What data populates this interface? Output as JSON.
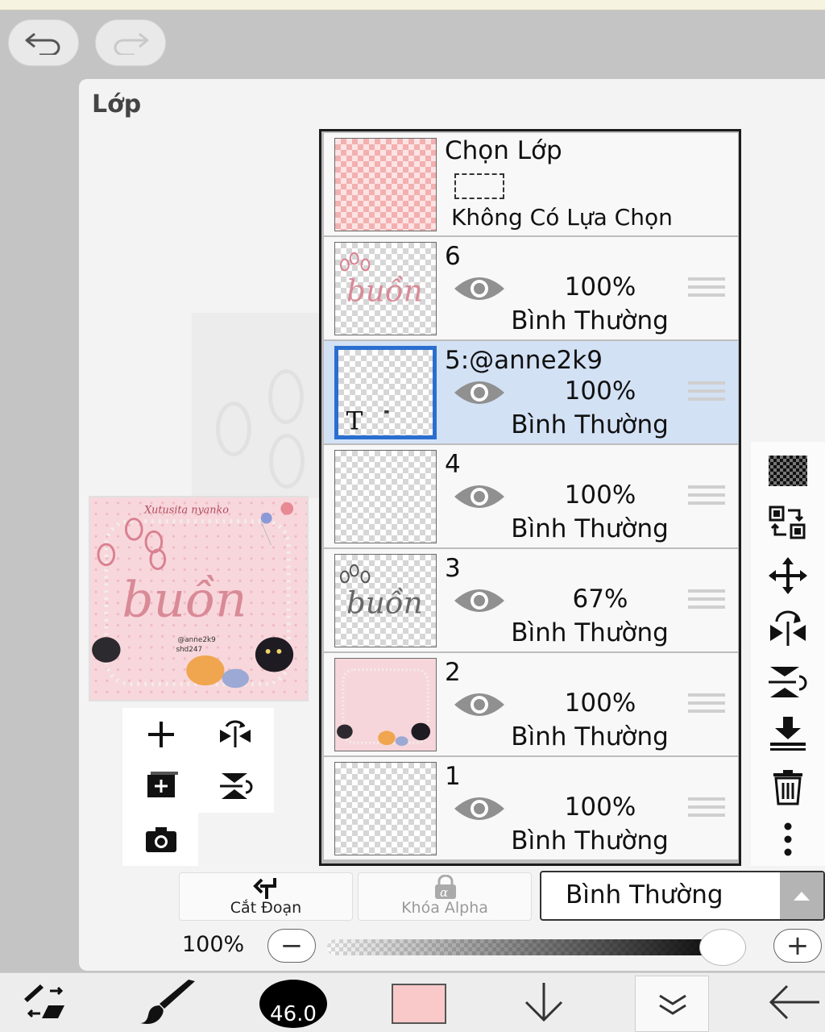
{
  "panel": {
    "title": "Lớp"
  },
  "selection_layer": {
    "title": "Chọn Lớp",
    "subtitle": "Không Có Lựa Chọn"
  },
  "layers": [
    {
      "name": "6",
      "opacity": "100%",
      "blend": "Bình Thường",
      "selected": false
    },
    {
      "name": "5:@anne2k9",
      "opacity": "100%",
      "blend": "Bình Thường",
      "selected": true
    },
    {
      "name": "4",
      "opacity": "100%",
      "blend": "Bình Thường",
      "selected": false
    },
    {
      "name": "3",
      "opacity": "67%",
      "blend": "Bình Thường",
      "selected": false
    },
    {
      "name": "2",
      "opacity": "100%",
      "blend": "Bình Thường",
      "selected": false
    },
    {
      "name": "1",
      "opacity": "100%",
      "blend": "Bình Thường",
      "selected": false
    }
  ],
  "preview": {
    "header": "Xutusita nyanko",
    "word": "buồn",
    "tag1": "@anne2k9",
    "tag2": "shd247"
  },
  "bottom_controls": {
    "clip_label": "Cắt Đoạn",
    "alpha_lock_label": "Khóa Alpha",
    "blend_mode": "Bình Thường",
    "opacity_label": "100%",
    "opacity_value": 1.0,
    "minus": "−",
    "plus": "+"
  },
  "toolbar": {
    "brush_size": "46.0",
    "color": "#f9c9c9"
  },
  "icons": {
    "undo": "undo-icon",
    "redo": "redo-icon",
    "right": [
      "checker-icon",
      "transfer-icon",
      "move-icon",
      "flip-horizontal-icon",
      "flip-vertical-icon",
      "merge-down-icon",
      "trash-icon",
      "more-icon"
    ]
  }
}
